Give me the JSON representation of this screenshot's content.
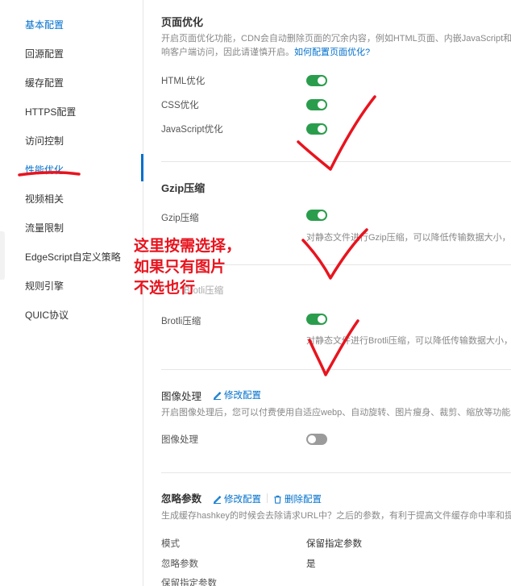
{
  "sidebar": {
    "items": [
      {
        "label": "基本配置"
      },
      {
        "label": "回源配置"
      },
      {
        "label": "缓存配置"
      },
      {
        "label": "HTTPS配置"
      },
      {
        "label": "访问控制"
      },
      {
        "label": "性能优化"
      },
      {
        "label": "视频相关"
      },
      {
        "label": "流量限制"
      },
      {
        "label": "EdgeScript自定义策略"
      },
      {
        "label": "规则引擎"
      },
      {
        "label": "QUIC协议"
      }
    ],
    "active_index": 5
  },
  "page_opt": {
    "title": "页面优化",
    "desc_line1": "开启页面优化功能，CDN会自动删除页面的冗余内容，例如HTML页面、内嵌JavaScript和C",
    "desc_line2": "响客户端访问，因此请谨慎开启。",
    "help_link": "如何配置页面优化?",
    "rows": [
      {
        "label": "HTML优化",
        "enabled": true
      },
      {
        "label": "CSS优化",
        "enabled": true
      },
      {
        "label": "JavaScript优化",
        "enabled": true
      }
    ]
  },
  "gzip": {
    "title": "Gzip压缩",
    "label": "Gzip压缩",
    "enabled": true,
    "hint": "对静态文件进行Gzip压缩，可以降低传输数据大小，若"
  },
  "brotli": {
    "hidden_title": "Brotli压缩",
    "label": "Brotli压缩",
    "enabled": true,
    "hint": "对静态文件进行Brotli压缩，可以降低传输数据大小，寻"
  },
  "image": {
    "title": "图像处理",
    "edit_label": "修改配置",
    "desc": "开启图像处理后，您可以付费使用自适应webp、自动旋转、图片瘦身、裁剪、缩放等功能。",
    "label": "图像处理",
    "enabled": false
  },
  "ignore_params": {
    "title": "忽略参数",
    "edit_label": "修改配置",
    "delete_label": "删除配置",
    "desc": "生成缓存hashkey的时候会去除请求URL中？之后的参数，有利于提高文件缓存命中率和提升",
    "rows": [
      {
        "label": "模式",
        "value": "保留指定参数"
      },
      {
        "label": "忽略参数",
        "value": "是"
      },
      {
        "label": "保留指定参数",
        "value": ""
      }
    ]
  },
  "annotation": {
    "lines": [
      "这里按需选择，",
      "如果只有图片",
      "不选也行"
    ],
    "color": "#e8141e"
  },
  "colors": {
    "accent": "#0070cc",
    "toggle_on": "#2a9d4c",
    "toggle_off": "#9b9b9b"
  }
}
